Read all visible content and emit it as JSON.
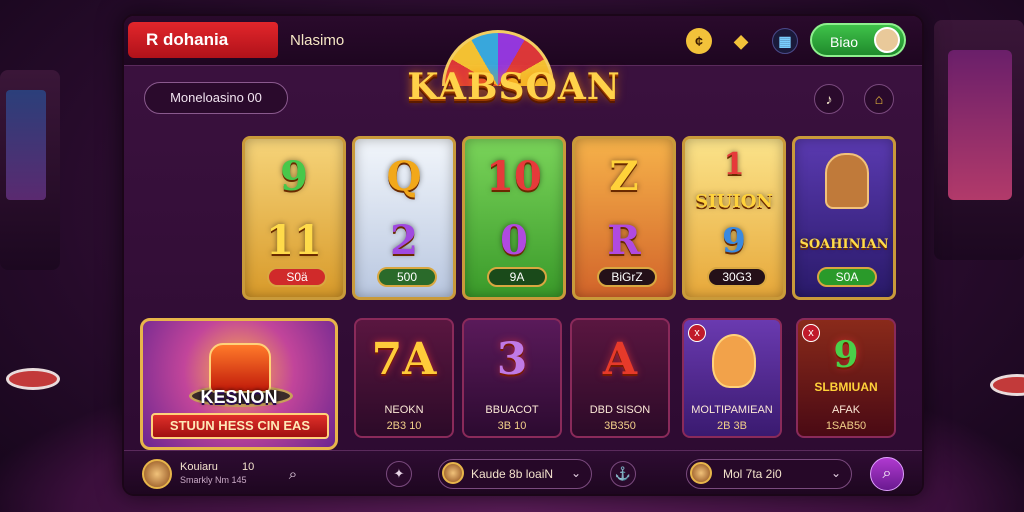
{
  "header": {
    "brand": "R dohania",
    "site_name": "Nlasimo",
    "login_label": "Biao"
  },
  "search": {
    "label": "Moneloasino 00"
  },
  "logo": {
    "text": "KABSOAN"
  },
  "slots": [
    {
      "sym1": "9",
      "sym2": "11",
      "badge": "S0ä",
      "bg": "#f0b84a"
    },
    {
      "sym1": "Q",
      "sym2": "2",
      "badge": "500",
      "bg": "#dfe8f4"
    },
    {
      "sym1": "10",
      "sym2": "0",
      "badge": "9A",
      "bg": "#5fb84a"
    },
    {
      "sym1": "Z",
      "sym2": "R",
      "badge": "BiGrZ",
      "bg": "#ea9a3a"
    },
    {
      "sym1": "1",
      "sym2": "9",
      "mid": "SIUION",
      "badge": "30G3",
      "bg": "#f2c64a"
    },
    {
      "sym1": "",
      "sym2": "",
      "mid": "SOAHINIAN",
      "badge": "S0A",
      "bg": "#3a3aa0"
    }
  ],
  "featured": {
    "title": "KESNON",
    "banner": "STUUN HESS CIN EAS"
  },
  "cards": [
    {
      "sym": "7A",
      "name": "NEOKN",
      "value": "2B3 10"
    },
    {
      "sym": "3",
      "name": "BBUACOT",
      "value": "3B 10"
    },
    {
      "sym": "A",
      "name": "DBD SISON",
      "value": "3B350"
    },
    {
      "sym": "",
      "name": "MOLTIPAMIEAN",
      "value": "2B 3B",
      "close": "x"
    },
    {
      "sym": "9",
      "mid": "SLBMIUAN",
      "name": "AFAK",
      "value": "1SAB50",
      "close": "x"
    }
  ],
  "bottombar": {
    "user_text": "Kouiaru",
    "user_sub": "Smarkly Nm 145",
    "user_num": "10",
    "game_text": "Kaude 8b loaiN",
    "game2_text": "Mol 7ta 2i0"
  },
  "colors": {
    "accent_red": "#e2262b",
    "accent_green": "#3fc24a",
    "gold": "#e7b54a",
    "purple": "#6a1a90"
  }
}
